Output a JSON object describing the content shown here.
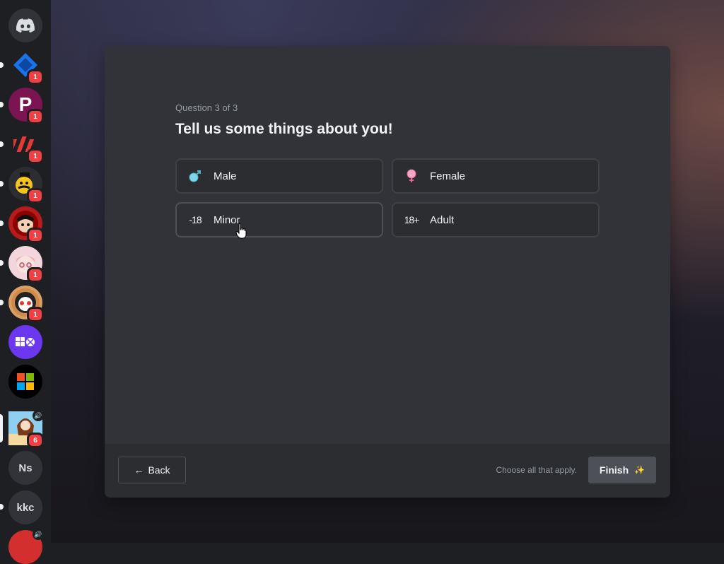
{
  "sidebar": {
    "items": [
      {
        "name": "discord-home",
        "badge": ""
      },
      {
        "name": "server-blue-diamond",
        "badge": "1"
      },
      {
        "name": "server-p-logo",
        "badge": "1"
      },
      {
        "name": "server-red-stripes",
        "badge": "1"
      },
      {
        "name": "server-yellow-mustache",
        "badge": "1"
      },
      {
        "name": "server-anime-red",
        "badge": "1"
      },
      {
        "name": "server-anime-pink",
        "badge": "1"
      },
      {
        "name": "server-round-face",
        "badge": "1"
      },
      {
        "name": "server-xbox-purple",
        "badge": ""
      },
      {
        "name": "server-microsoft",
        "badge": ""
      },
      {
        "name": "server-anime-beach",
        "badge": "6"
      },
      {
        "name": "server-ns",
        "label": "Ns"
      },
      {
        "name": "server-kkc",
        "label": "kkc"
      }
    ]
  },
  "modal": {
    "question_count": "Question 3 of 3",
    "title": "Tell us some things about you!",
    "options": [
      {
        "label": "Male",
        "icon": "male-icon"
      },
      {
        "label": "Female",
        "icon": "female-icon"
      },
      {
        "label": "Minor",
        "icon": "minus-18-icon"
      },
      {
        "label": "Adult",
        "icon": "18-plus-icon"
      }
    ],
    "back_label": "Back",
    "hint": "Choose all that apply.",
    "finish_label": "Finish"
  },
  "colors": {
    "modal_bg": "#313338",
    "footer_bg": "#2b2d31",
    "badge_red": "#f23f43",
    "xbox_purple": "#6b38f0"
  }
}
